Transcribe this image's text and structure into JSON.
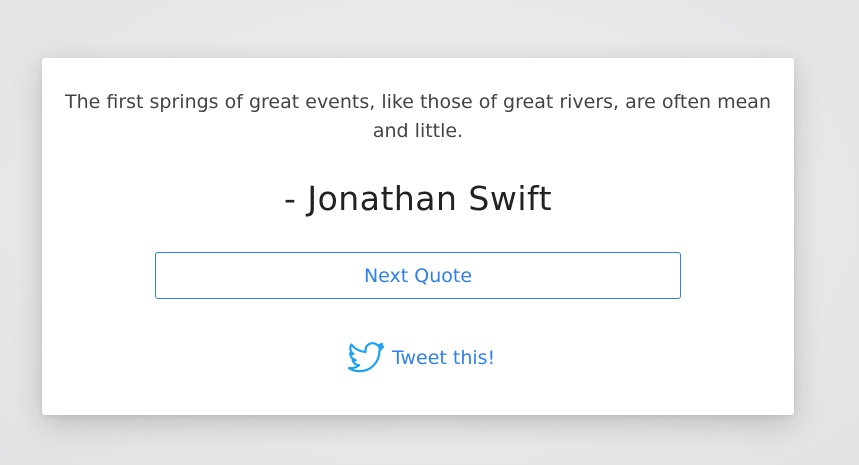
{
  "quote": {
    "text": "The first springs of great events, like those of great rivers, are often mean and little.",
    "author": "- Jonathan Swift"
  },
  "actions": {
    "next_label": "Next Quote",
    "tweet_label": "Tweet this!",
    "tweet_icon": "twitter-bird-icon"
  },
  "colors": {
    "accent": "#2f80ed",
    "twitter_blue": "#1da1f2",
    "text": "#444444",
    "author": "#222222",
    "card_bg": "#ffffff"
  }
}
